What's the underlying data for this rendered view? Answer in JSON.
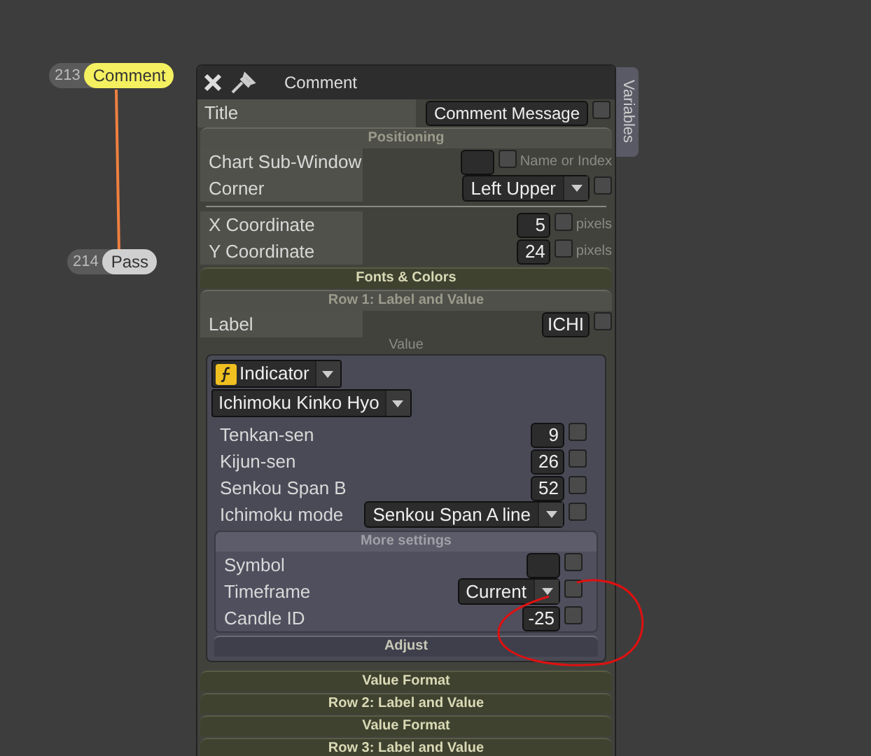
{
  "nodes": [
    {
      "number": "213",
      "label": "Comment",
      "selected": true
    },
    {
      "number": "214",
      "label": "Pass",
      "selected": false
    }
  ],
  "panel": {
    "title": "Comment",
    "side_tab": "Variables",
    "title_row": {
      "label": "Title",
      "value": "Comment Message",
      "checked": false
    },
    "sections": [
      {
        "title": "Positioning",
        "expanded": true,
        "rows": [
          {
            "kind": "input",
            "label": "Chart Sub-Window",
            "checked": false,
            "note": "Name or Index"
          },
          {
            "kind": "select",
            "label": "Corner",
            "value": "Left Upper",
            "checked": false
          },
          {
            "kind": "divider"
          },
          {
            "kind": "input",
            "label": "X Coordinate",
            "value": "5",
            "checked": false,
            "note": "pixels"
          },
          {
            "kind": "input",
            "label": "Y Coordinate",
            "value": "24",
            "checked": false,
            "note": "pixels"
          }
        ]
      },
      {
        "title": "Fonts & Colors",
        "expanded": false
      },
      {
        "title": "Row 1: Label and Value",
        "expanded": true,
        "rows": [
          {
            "kind": "input",
            "label": "Label",
            "value": "ICHI",
            "checked": false
          }
        ],
        "value": {
          "caption": "Value",
          "source": "Indicator",
          "indicator": "Ichimoku Kinko Hyo",
          "params": [
            {
              "kind": "input",
              "label": "Tenkan-sen",
              "value": "9",
              "checked": false
            },
            {
              "kind": "input",
              "label": "Kijun-sen",
              "value": "26",
              "checked": false
            },
            {
              "kind": "input",
              "label": "Senkou Span B",
              "value": "52",
              "checked": false
            },
            {
              "kind": "select",
              "label": "Ichimoku mode",
              "value": "Senkou Span A line",
              "checked": false
            }
          ],
          "more": {
            "title": "More settings",
            "rows": [
              {
                "kind": "input",
                "label": "Symbol",
                "checked": false
              },
              {
                "kind": "select",
                "label": "Timeframe",
                "value": "Current",
                "checked": false
              },
              {
                "kind": "input",
                "label": "Candle ID",
                "value": "-25",
                "checked": false
              }
            ]
          },
          "adjust": "Adjust"
        }
      },
      {
        "title": "Value Format",
        "expanded": false
      },
      {
        "title": "Row 2: Label and Value",
        "expanded": false
      },
      {
        "title": "Value Format",
        "expanded": false
      },
      {
        "title": "Row 3: Label and Value",
        "expanded": false
      }
    ]
  }
}
